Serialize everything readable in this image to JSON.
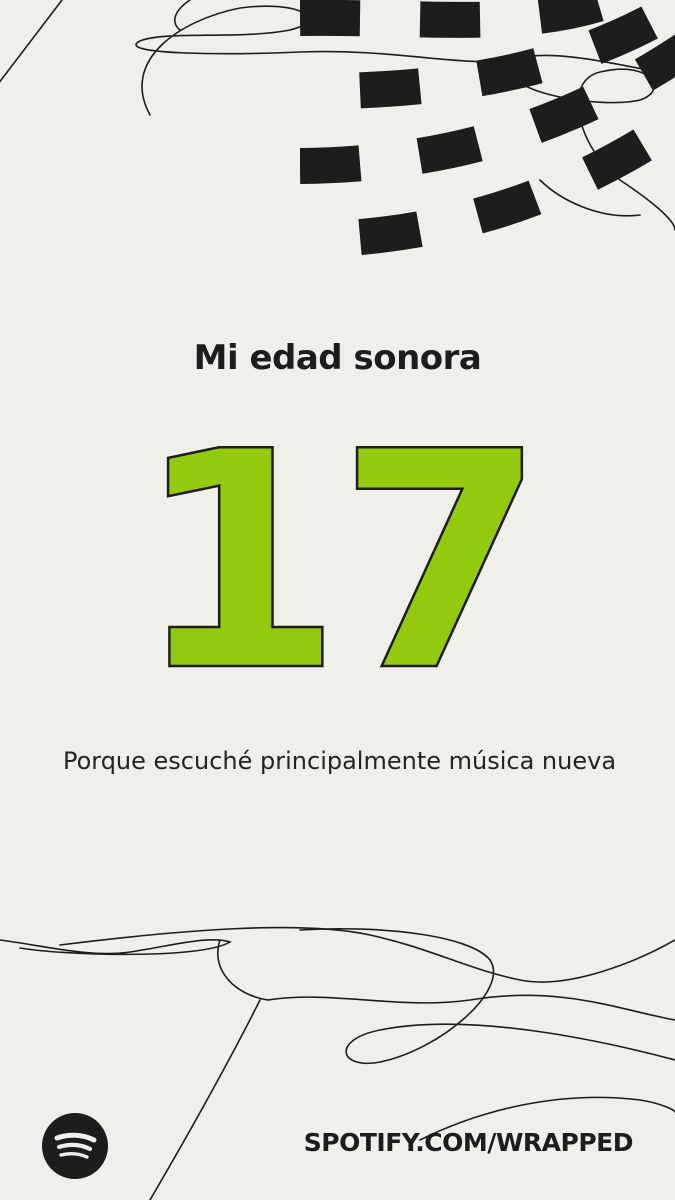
{
  "story": {
    "title": "Mi edad sonora",
    "age": "17",
    "reason": "Porque escuché principalmente música nueva",
    "footer_url": "SPOTIFY.COM/WRAPPED"
  },
  "colors": {
    "background": "#efefeb",
    "accent_green": "#93c90e",
    "ink": "#1d1d1d"
  },
  "icons": {
    "logo": "spotify-logo-icon"
  }
}
